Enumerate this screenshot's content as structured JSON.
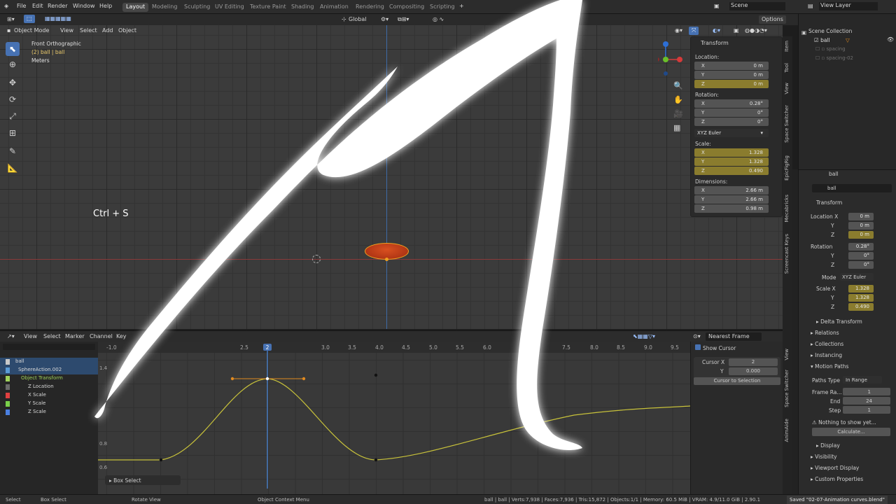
{
  "topbar": {
    "menus": [
      "File",
      "Edit",
      "Render",
      "Window",
      "Help"
    ],
    "workspaces": [
      "Layout",
      "Modeling",
      "Sculpting",
      "UV Editing",
      "Texture Paint",
      "Shading",
      "Animation",
      "Rendering",
      "Compositing",
      "Scripting"
    ],
    "active_workspace": "Layout",
    "scene": "Scene",
    "view_layer": "View Layer",
    "transform_orientation": "Global",
    "options": "Options"
  },
  "viewport": {
    "mode": "Object Mode",
    "menus": [
      "View",
      "Select",
      "Add",
      "Object"
    ],
    "overlay_title": "Front Orthographic",
    "overlay_object": "(2) ball | ball",
    "overlay_units": "Meters",
    "key_hint": "Ctrl + S"
  },
  "n_panel": {
    "header": "Transform",
    "location_label": "Location:",
    "location": [
      {
        "axis": "X",
        "value": "0 m"
      },
      {
        "axis": "Y",
        "value": "0 m"
      },
      {
        "axis": "Z",
        "value": "0 m"
      }
    ],
    "rotation_label": "Rotation:",
    "rotation": [
      {
        "axis": "X",
        "value": "0.28°"
      },
      {
        "axis": "Y",
        "value": "0°"
      },
      {
        "axis": "Z",
        "value": "0°"
      }
    ],
    "rotation_mode": "XYZ Euler",
    "scale_label": "Scale:",
    "scale": [
      {
        "axis": "X",
        "value": "1.328"
      },
      {
        "axis": "Y",
        "value": "1.328"
      },
      {
        "axis": "Z",
        "value": "0.490"
      }
    ],
    "dimensions_label": "Dimensions:",
    "dimensions": [
      {
        "axis": "X",
        "value": "2.66 m"
      },
      {
        "axis": "Y",
        "value": "2.66 m"
      },
      {
        "axis": "Z",
        "value": "0.98 m"
      }
    ]
  },
  "side_tabs": [
    "Item",
    "Tool",
    "View",
    "Space Switcher",
    "EpicFigRig",
    "Mecabricks",
    "Screencast Keys"
  ],
  "outliner": {
    "root": "Scene Collection",
    "items": [
      "ball",
      "spacing",
      "spacing-02"
    ]
  },
  "properties": {
    "object_name": "ball",
    "object_field": "ball",
    "transform_header": "Transform",
    "location_label": "Location X",
    "location": [
      "0 m",
      "0 m",
      "0 m"
    ],
    "rotation_label": "Rotation",
    "rotation": [
      "0.28°",
      "0°",
      "0°"
    ],
    "mode_label": "Mode",
    "mode_value": "XYZ Euler",
    "scale_label": "Scale X",
    "scale": [
      "1.328",
      "1.328",
      "0.490"
    ],
    "axis_y": "Y",
    "axis_z": "Z",
    "sections": [
      "Delta Transform",
      "Relations",
      "Collections",
      "Instancing",
      "Motion Paths"
    ],
    "paths_type_label": "Paths Type",
    "paths_type_value": "In Range",
    "frame_range_label": "Frame Ra...",
    "frame_range_value": "1",
    "end_label": "End",
    "end_value": "24",
    "step_label": "Step",
    "step_value": "1",
    "warning": "Nothing to show yet...",
    "calculate": "Calculate...",
    "lower_sections": [
      "Display",
      "Visibility",
      "Viewport Display",
      "Custom Properties"
    ]
  },
  "graph_editor": {
    "menus": [
      "View",
      "Select",
      "Marker",
      "Channel",
      "Key"
    ],
    "interpolation": "Nearest Frame",
    "ruler_ticks": [
      "-1.0",
      "2.5",
      "3.0",
      "3.5",
      "4.0",
      "4.5",
      "5.0",
      "5.5",
      "6.0",
      "7.5",
      "8.0",
      "8.5",
      "9.0",
      "9.5"
    ],
    "current_frame": "2",
    "y_ticks": [
      "1.4",
      "0.8",
      "0.6"
    ],
    "channels": [
      {
        "label": "ball",
        "color": "#c9c9c9"
      },
      {
        "label": "SphereAction.002",
        "color": "#5b9bd5"
      },
      {
        "label": "Object Transform",
        "color": "#9fd15b"
      },
      {
        "label": "Z Location",
        "color": "#6a6a6a"
      },
      {
        "label": "X Scale",
        "color": "#e04040"
      },
      {
        "label": "Y Scale",
        "color": "#7ad04a"
      },
      {
        "label": "Z Scale",
        "color": "#4a7fe0"
      }
    ],
    "sidebar_tabs": [
      "View",
      "Space Switcher",
      "AnimAide"
    ],
    "show_cursor": "Show Cursor",
    "cursor_x_label": "Cursor X",
    "cursor_x_value": "2",
    "cursor_y_label": "Y",
    "cursor_y_value": "0.000",
    "cursor_to_selection": "Cursor to Selection",
    "box_select": "Box Select",
    "curve_color": "#c8c23a"
  },
  "statusbar": {
    "select": "Select",
    "box_select": "Box Select",
    "rotate_view": "Rotate View",
    "context_menu": "Object Context Menu",
    "stats": "ball | ball | Verts:7,938 | Faces:7,936 | Tris:15,872 | Objects:1/1 | Memory: 60.5 MiB | VRAM: 4.9/11.0 GiB | 2.90.1",
    "saved": "Saved \"02-07-Animation curves.blend\""
  }
}
